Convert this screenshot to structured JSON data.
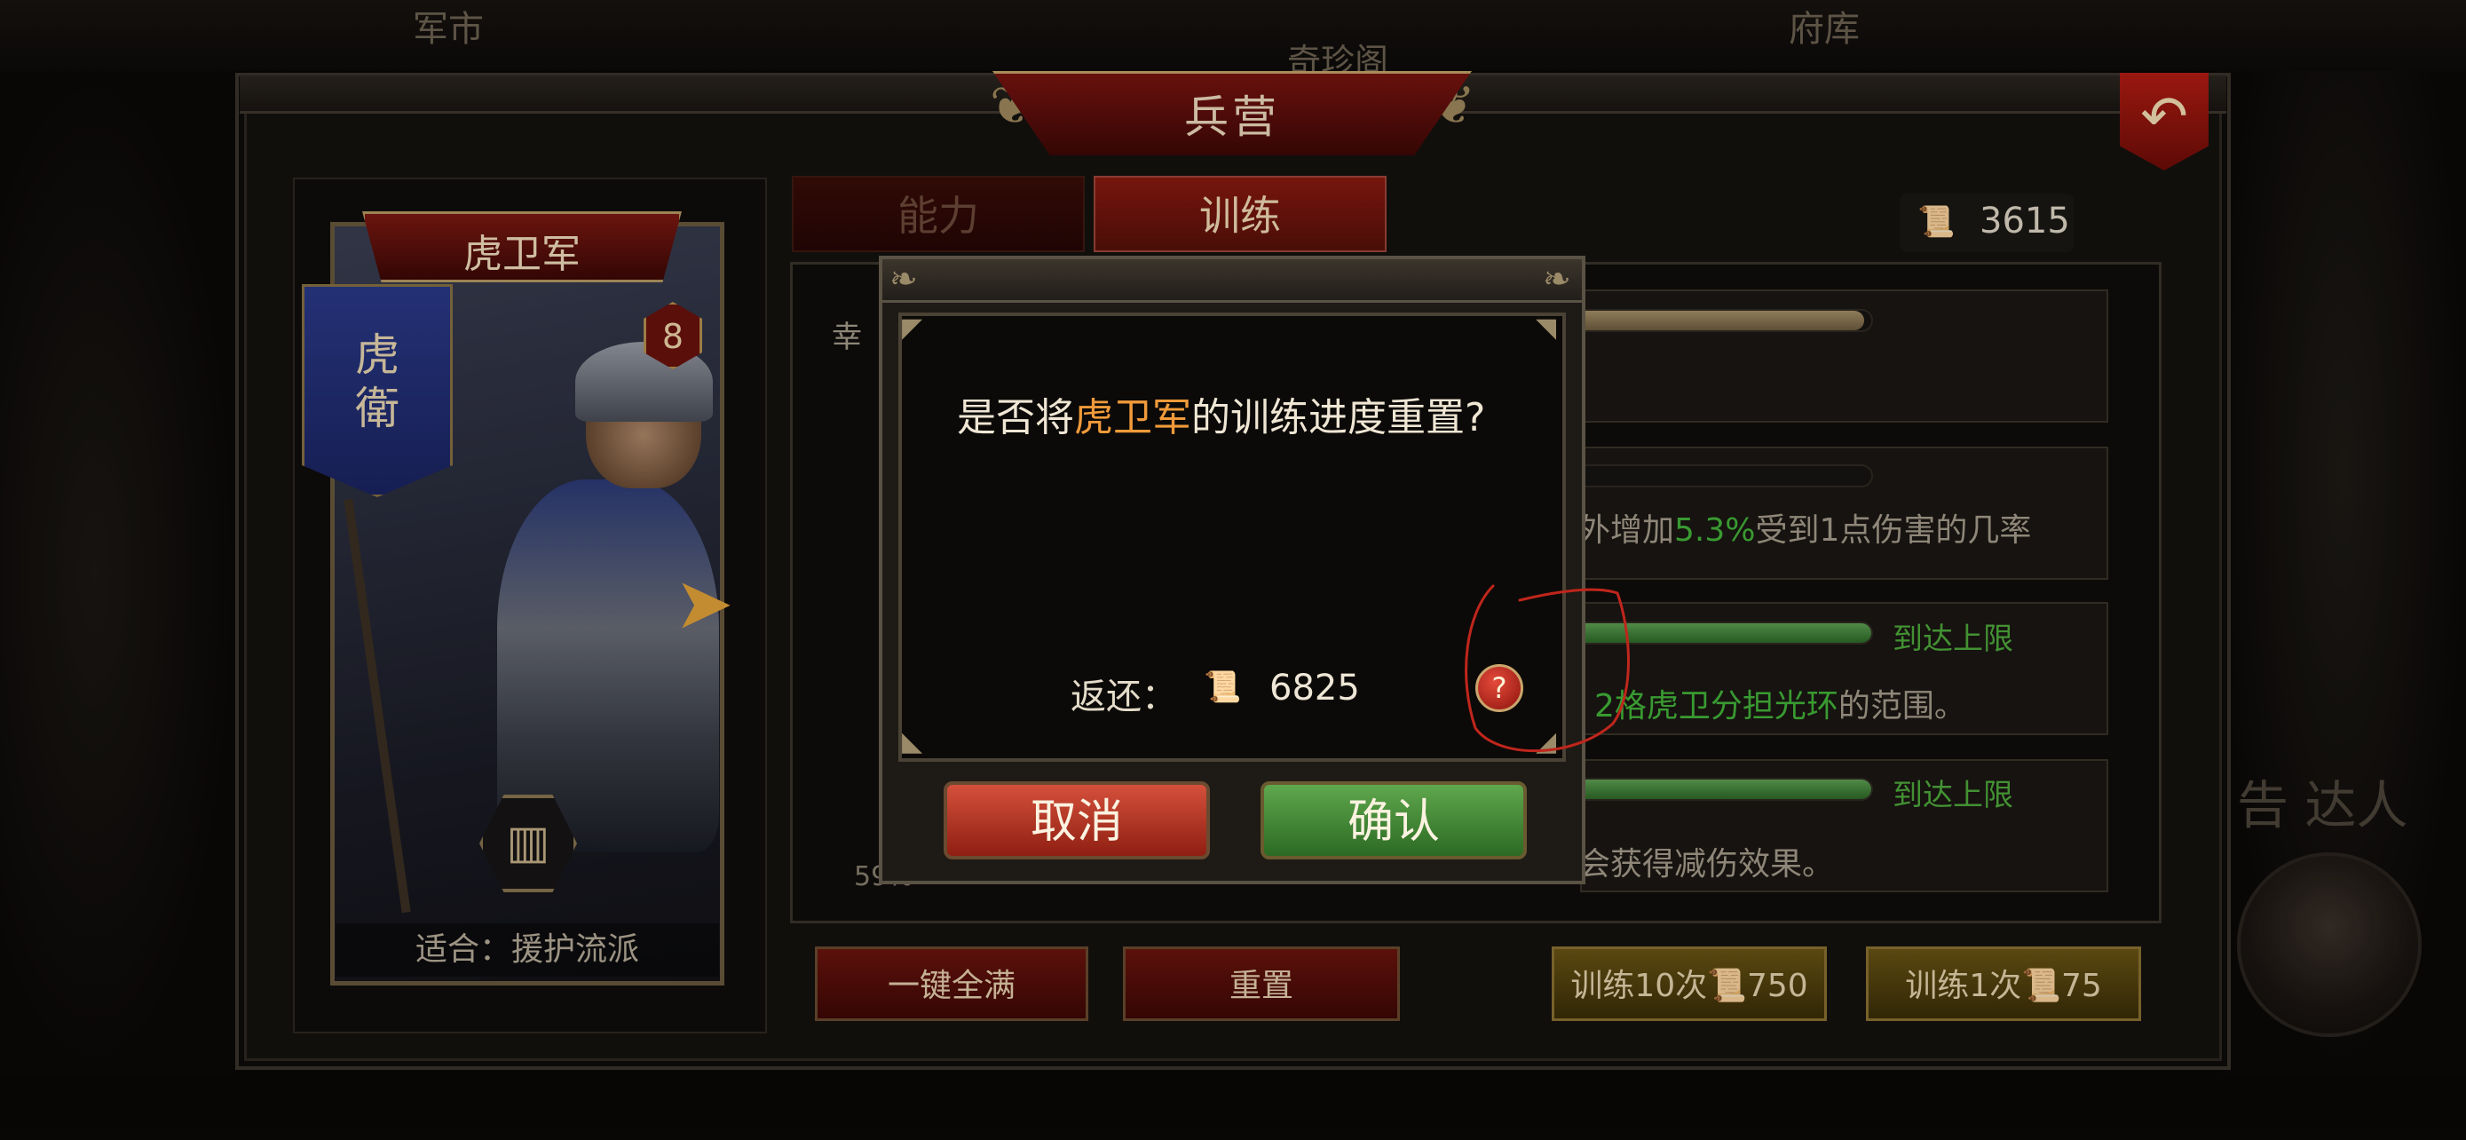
{
  "background": {
    "top_labels": [
      "军市",
      "奇珍阁",
      "府库"
    ],
    "right_text": "告 达人"
  },
  "window": {
    "title": "兵营",
    "back_icon": "back-arrow-icon"
  },
  "unit_card": {
    "name": "虎卫军",
    "level": "8",
    "flag_chars": [
      "虎",
      "衛"
    ],
    "suitable_label": "适合：援护流派",
    "skill_icon": "skill-emblem-icon",
    "next_icon": "arrow-right-icon"
  },
  "tabs": [
    {
      "label": "能力",
      "active": false
    },
    {
      "label": "训练",
      "active": true
    }
  ],
  "currency": {
    "icon": "scroll-icon",
    "value": "3615"
  },
  "training_rows": [
    {
      "progress": 0.98,
      "reached": false,
      "reach_label": "",
      "desc_parts": []
    },
    {
      "progress": 0.0,
      "reached": false,
      "reach_label": "",
      "desc_parts": [
        {
          "text": "外增加",
          "color": "normal"
        },
        {
          "text": "5.3%",
          "color": "green"
        },
        {
          "text": "受到1点伤害的几率",
          "color": "normal"
        }
      ]
    },
    {
      "progress": 1.0,
      "reached": true,
      "reach_label": "到达上限",
      "desc_parts": [
        {
          "text": "2格",
          "color": "green"
        },
        {
          "text": "虎卫分担光环",
          "color": "green"
        },
        {
          "text": "的范围。",
          "color": "normal"
        }
      ]
    },
    {
      "progress": 1.0,
      "reached": true,
      "reach_label": "到达上限",
      "desc_parts": [
        {
          "text": "会获得减伤效果。",
          "color": "normal"
        }
      ]
    }
  ],
  "partial_labels": {
    "left_edge_text": "幸",
    "left_edge_pct": "59%"
  },
  "bottom_buttons": {
    "fill_all": "一键全满",
    "reset": "重置",
    "train10_label": "训练10次",
    "train10_cost": "750",
    "train1_label": "训练1次",
    "train1_cost": "75"
  },
  "dialog": {
    "message_prefix": "是否将",
    "message_highlight": "虎卫军",
    "message_suffix": "的训练进度重置?",
    "refund_label": "返还：",
    "refund_icon": "scroll-icon",
    "refund_value": "6825",
    "help_label": "?",
    "cancel_label": "取消",
    "confirm_label": "确认"
  },
  "colors": {
    "highlight": "#f09a3a",
    "green": "#43b53a",
    "annotation": "#c0261c"
  }
}
